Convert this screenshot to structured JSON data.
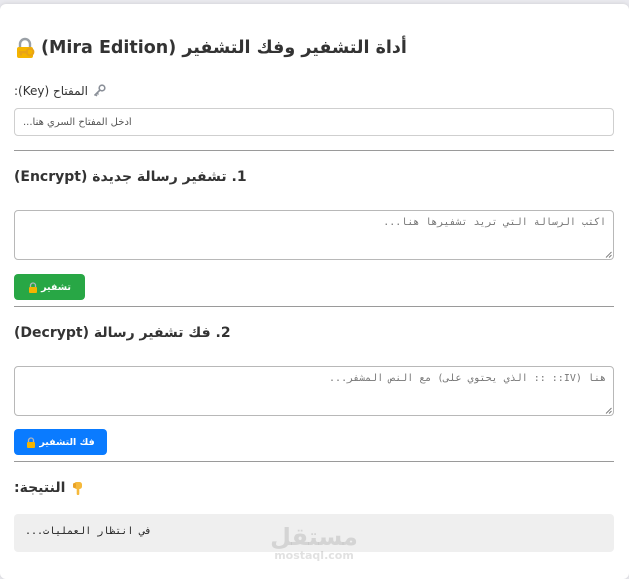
{
  "header": {
    "title": "أداة التشفير وفك التشفير (Mira Edition)",
    "title_icon": "lock-with-key-icon"
  },
  "key": {
    "label": "المفتاح (Key):",
    "label_icon": "key-icon",
    "placeholder": "أدخل المفتاح السري هنا..."
  },
  "encrypt": {
    "title": "1. تشفير رسالة جديدة (Encrypt)",
    "placeholder": "اكتب الرسالة التي تريد تشفيرها هنا...",
    "button_label": "تشفير",
    "button_icon": "lock-icon",
    "button_color": "#28a745"
  },
  "decrypt": {
    "title": "2. فك تشفير رسالة (Decrypt)",
    "placeholder": "هنا (IV:: :: الذي يحتوي على) مع النص المشفر...",
    "button_label": "فك التشفير",
    "button_icon": "lock-icon",
    "button_color": "#0a7bff"
  },
  "result": {
    "title": "النتيجة:",
    "title_icon": "pointing-down-icon",
    "value": "في انتظار العمليات..."
  },
  "watermark": {
    "arabic": "مستقل",
    "latin": "mostaql.com"
  }
}
